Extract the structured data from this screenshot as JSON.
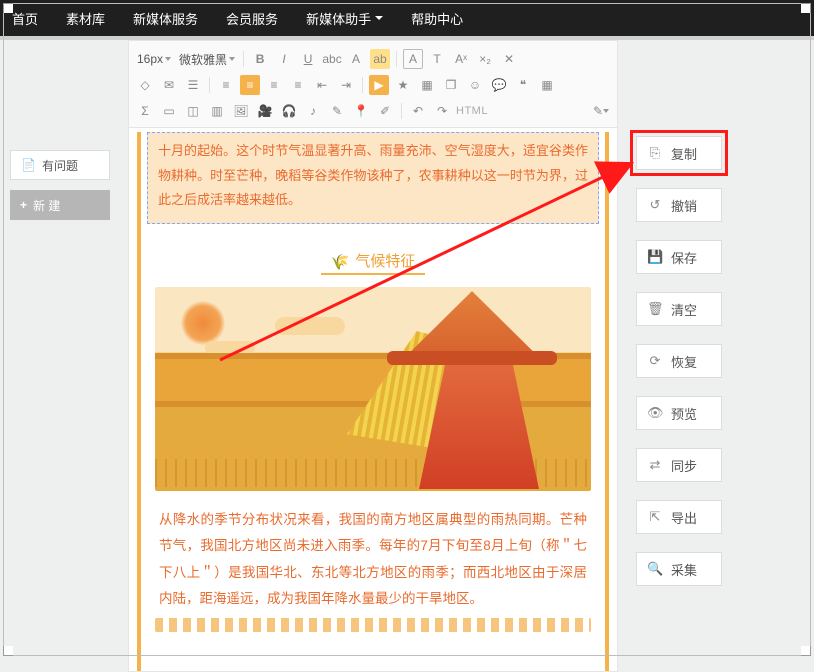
{
  "nav": {
    "items": [
      "首页",
      "素材库",
      "新媒体服务",
      "会员服务",
      "新媒体助手",
      "帮助中心"
    ],
    "dropdown_index": 4
  },
  "left": {
    "issue_label": "有问题",
    "new_label": "新 建",
    "issue_icon": "file-icon",
    "new_icon": "plus-icon"
  },
  "toolbar": {
    "font_size": "16px",
    "font_family": "微软雅黑",
    "row1_icons": [
      "bold-icon",
      "italic-icon",
      "underline-icon",
      "strike-icon",
      "fontcolor-icon",
      "highlight-icon",
      "charbox-icon",
      "textfx-icon",
      "superscript-icon",
      "subscript-icon",
      "clear-icon"
    ],
    "row2_icons": [
      "link-icon",
      "mail-icon",
      "checklist-icon",
      "align-left-icon",
      "align-center-icon",
      "align-right-icon",
      "align-justify-icon",
      "indent-dec-icon",
      "indent-inc-icon",
      "tag-icon",
      "star-icon",
      "cards-icon",
      "layers-icon",
      "smile-icon",
      "chat-icon",
      "quote-icon",
      "table-icon"
    ],
    "row3_icons": [
      "sigma-icon",
      "frame-icon",
      "split-icon",
      "columns-icon",
      "image-icon",
      "video-icon",
      "audio-icon",
      "music-icon",
      "brush-icon",
      "map-icon",
      "eyedrop-icon",
      "undo-icon",
      "redo-icon"
    ],
    "html_label": "HTML",
    "edit_dropdown_icon": "edit-square-icon",
    "align_selected_index": 1,
    "tag_selected": true
  },
  "article": {
    "selected_text": "十月的起始。这个时节气温显著升高、雨量充沛、空气湿度大，适宜谷类作物耕种。时至芒种，晚稻等谷类作物该种了，农事耕种以这一时节为界，过此之后成活率越来越低。",
    "section_title": "气候特征",
    "section_icon": "wheat-icon",
    "body_text": "从降水的季节分布状况来看，我国的南方地区属典型的雨热同期。芒种节气，我国北方地区尚未进入雨季。每年的7月下旬至8月上旬（称＂七下八上＂）是我国华北、东北等北方地区的雨季；而西北地区由于深居内陆，距海遥远，成为我国年降水量最少的干旱地区。"
  },
  "side": {
    "buttons": [
      {
        "icon": "copy-icon",
        "label": "复制"
      },
      {
        "icon": "undo2-icon",
        "label": "撤销"
      },
      {
        "icon": "save-icon",
        "label": "保存"
      },
      {
        "icon": "trash-icon",
        "label": "清空"
      },
      {
        "icon": "restore-icon",
        "label": "恢复"
      },
      {
        "icon": "eye-icon",
        "label": "预览"
      },
      {
        "icon": "sync-icon",
        "label": "同步"
      },
      {
        "icon": "export-icon",
        "label": "导出"
      },
      {
        "icon": "collect-icon",
        "label": "采集"
      }
    ],
    "highlight_index": 0
  },
  "colors": {
    "accent": "#f6b24a",
    "article_text": "#e96b2e",
    "highlight_red": "#ff1a1a"
  }
}
